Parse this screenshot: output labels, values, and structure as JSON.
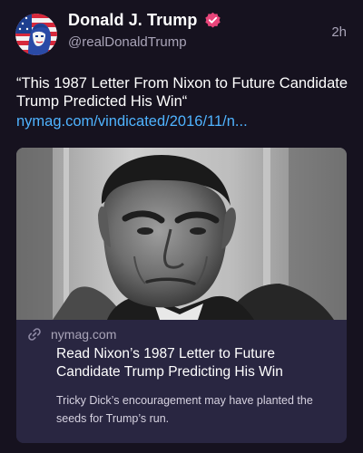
{
  "post": {
    "author": {
      "display_name": "Donald J. Trump",
      "handle": "@realDonaldTrump",
      "verified_icon": "verified-badge-icon",
      "avatar_icon": "avatar-flag-portrait"
    },
    "timestamp": "2h",
    "text": "“This 1987 Letter From Nixon to Future Candidate Trump Predicted His Win“",
    "link_text": "nymag.com/vindicated/2016/11/n..."
  },
  "link_card": {
    "domain": "nymag.com",
    "domain_icon": "link-icon",
    "title": "Read Nixon’s 1987 Letter to Future Candidate Trump Predicting His Win",
    "description": "Tricky Dick’s encouragement may have planted the seeds for Trump’s run.",
    "image_icon": "black-and-white-portrait-photo"
  },
  "colors": {
    "background": "#16121f",
    "card_background": "#292641",
    "link": "#4fb3ff",
    "muted_text": "#a9a4b8",
    "verified_badge": "#e8457a"
  }
}
